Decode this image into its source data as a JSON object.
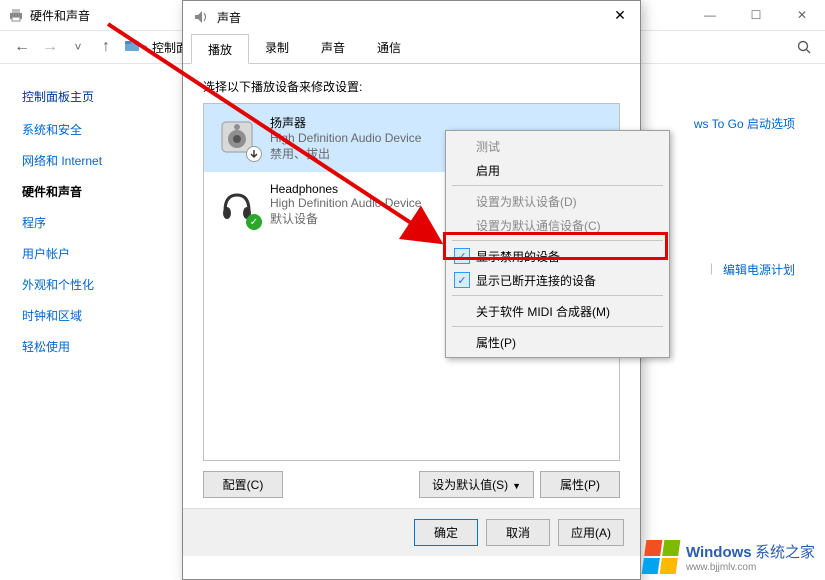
{
  "bg": {
    "title": "硬件和声音",
    "breadcrumb": [
      "控制面..."
    ],
    "win_min": "—",
    "win_max": "☐",
    "win_close": "✕"
  },
  "sidebar": {
    "title": "控制面板主页",
    "items": [
      {
        "label": "系统和安全"
      },
      {
        "label": "网络和 Internet"
      },
      {
        "label": "硬件和声音",
        "active": true
      },
      {
        "label": "程序"
      },
      {
        "label": "用户帐户"
      },
      {
        "label": "外观和个性化"
      },
      {
        "label": "时钟和区域"
      },
      {
        "label": "轻松使用"
      }
    ]
  },
  "rightlinks": {
    "togo": "ws To Go 启动选项",
    "edit_plan": "编辑电源计划"
  },
  "dialog": {
    "title": "声音",
    "close": "✕",
    "tabs": [
      "播放",
      "录制",
      "声音",
      "通信"
    ],
    "active_tab": 0,
    "instruction": "选择以下播放设备来修改设置:",
    "devices": [
      {
        "name": "扬声器",
        "sub": "High Definition Audio Device",
        "status": "禁用、拔出",
        "selected": true,
        "badge": "down"
      },
      {
        "name": "Headphones",
        "sub": "High Definition Audio Device",
        "status": "默认设备",
        "selected": false,
        "badge": "ok"
      }
    ],
    "buttons": {
      "configure": "配置(C)",
      "set_default": "设为默认值(S)",
      "properties": "属性(P)",
      "ok": "确定",
      "cancel": "取消",
      "apply": "应用(A)"
    }
  },
  "context_menu": {
    "items": [
      {
        "label": "测试",
        "disabled": true
      },
      {
        "label": "启用"
      },
      {
        "sep": true
      },
      {
        "label": "设置为默认设备(D)",
        "disabled": true
      },
      {
        "label": "设置为默认通信设备(C)",
        "disabled": true
      },
      {
        "sep": true
      },
      {
        "label": "显示禁用的设备",
        "checked": true,
        "highlight": true
      },
      {
        "label": "显示已断开连接的设备",
        "checked": true
      },
      {
        "sep": true
      },
      {
        "label": "关于软件 MIDI 合成器(M)"
      },
      {
        "sep": true
      },
      {
        "label": "属性(P)"
      }
    ]
  },
  "logo": {
    "main": "Windows",
    "sub1": "系统之家",
    "sub2": "www.bjjmlv.com"
  }
}
